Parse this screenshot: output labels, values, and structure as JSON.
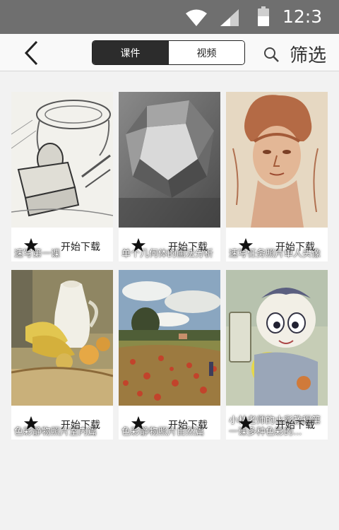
{
  "status": {
    "time": "12:3"
  },
  "header": {
    "tabs": [
      {
        "label": "课件",
        "active": true
      },
      {
        "label": "视频",
        "active": false
      }
    ],
    "filter_label": "筛选"
  },
  "cards": [
    {
      "caption": "速写第一课",
      "download_label": "开始下载"
    },
    {
      "caption": "单个几何体的画法分析",
      "download_label": "开始下载"
    },
    {
      "caption": "速写任务照片单人头像",
      "download_label": "开始下载"
    },
    {
      "caption": "色彩静物照片室内篇",
      "download_label": "开始下载"
    },
    {
      "caption": "色彩静物照片自然篇",
      "download_label": "开始下载"
    },
    {
      "caption": "小林老师的水彩教程第一课多种色彩的...",
      "download_label": "开始下载"
    }
  ],
  "colors": {
    "statusbar": "#6f6f6f",
    "header": "#f9f9f9",
    "background": "#f2f2f2",
    "active_tab": "#2c2c2c"
  }
}
